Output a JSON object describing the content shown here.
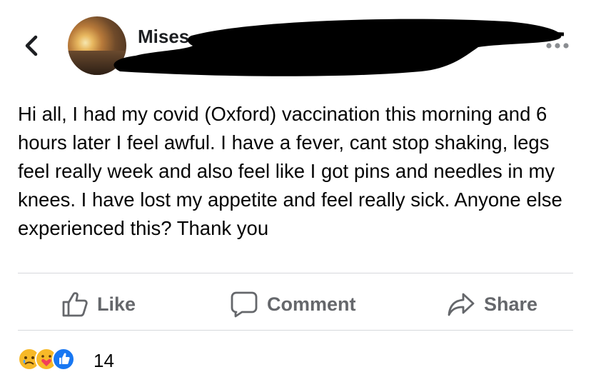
{
  "header": {
    "back_icon": "chevron-left-icon",
    "author_name": "Mises",
    "more_icon": "more-dots-icon"
  },
  "post": {
    "text": "Hi all, I had my covid (Oxford) vaccination  this morning and 6 hours later I feel awful. I have a fever, cant stop shaking, legs feel really week and also feel like I got pins and needles in my knees. I have lost my appetite and feel really sick. Anyone else experienced this? Thank you"
  },
  "actions": {
    "like_label": "Like",
    "comment_label": "Comment",
    "share_label": "Share"
  },
  "reactions": {
    "icons": [
      "sad-reaction-icon",
      "care-reaction-icon",
      "like-reaction-icon"
    ],
    "count": "14"
  },
  "colors": {
    "action_text": "#65676b",
    "divider": "#d6d8dc",
    "like_blue": "#1877f2",
    "reaction_yellow": "#f7b928"
  }
}
